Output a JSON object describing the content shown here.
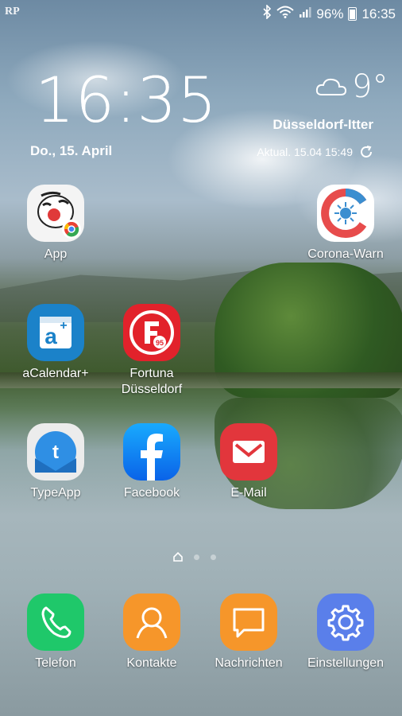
{
  "status_bar": {
    "left_logo": "RP",
    "battery": "96%",
    "time": "16:35"
  },
  "widget": {
    "time": "16:35",
    "date": "Do., 15. April",
    "temperature": "9°",
    "city": "Düsseldorf-Itter",
    "updated": "Aktual. 15.04 15:49"
  },
  "apps": [
    {
      "label": "App"
    },
    {
      "label": "Corona-Warn"
    },
    {
      "label": "aCalendar+"
    },
    {
      "label": "Fortuna\nDüsseldorf",
      "line1": "Fortuna",
      "line2": "Düsseldorf"
    },
    {
      "label": "TypeApp"
    },
    {
      "label": "Facebook"
    },
    {
      "label": "E-Mail"
    }
  ],
  "dock": [
    {
      "label": "Telefon",
      "color": "#1fc86a"
    },
    {
      "label": "Kontakte",
      "color": "#f6962a"
    },
    {
      "label": "Nachrichten",
      "color": "#f6962a"
    },
    {
      "label": "Einstellungen",
      "color": "#5a7fea"
    }
  ]
}
